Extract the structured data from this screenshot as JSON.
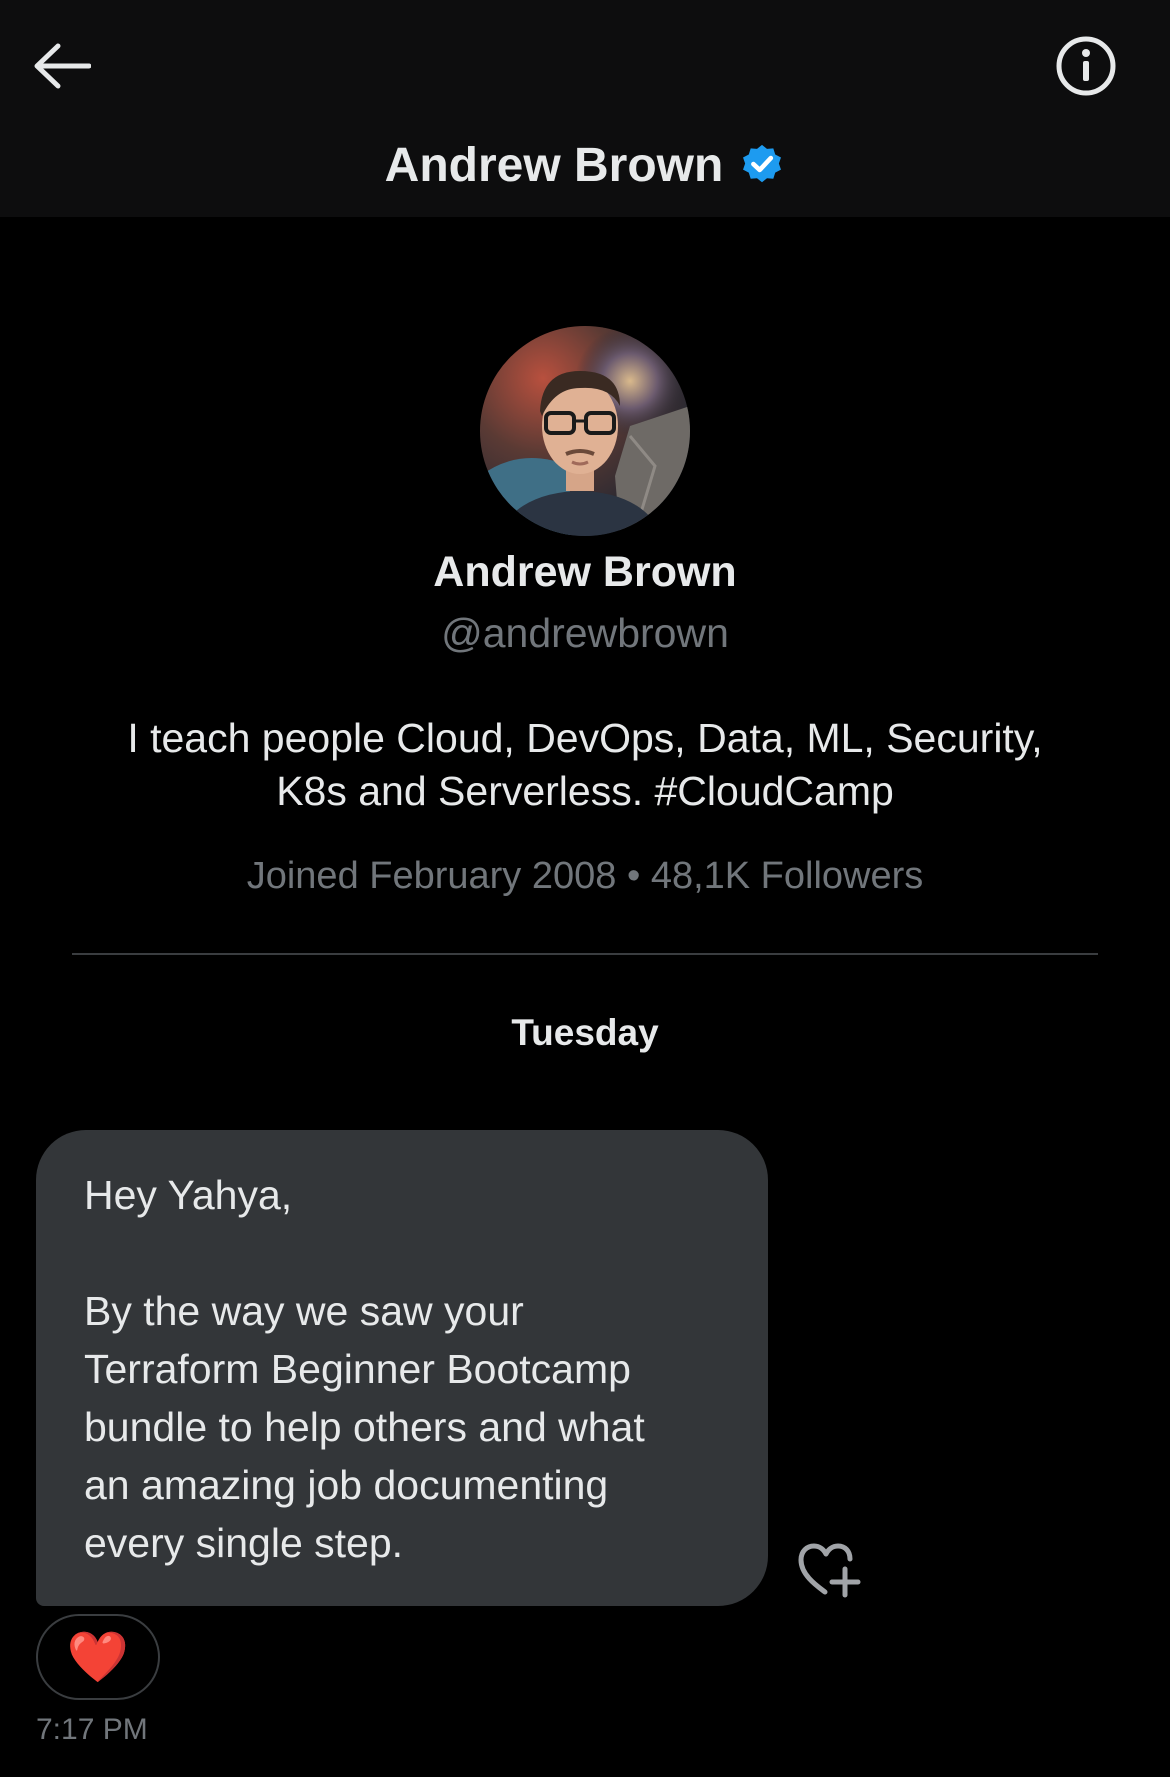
{
  "header": {
    "back_icon": "arrow-left-icon",
    "info_icon": "info-circle-icon",
    "title": "Andrew Brown",
    "verified_icon": "verified-badge-icon",
    "verified_color": "#1d9bf0"
  },
  "profile": {
    "name": "Andrew Brown",
    "handle": "@andrewbrown",
    "bio_line1": "I teach people Cloud, DevOps, Data, ML, Security,",
    "bio_line2": "K8s and Serverless. #CloudCamp",
    "meta": "Joined February 2008 • 48,1K Followers"
  },
  "conversation": {
    "day_label": "Tuesday",
    "message": {
      "greeting": "Hey Yahya,",
      "body_lines": [
        "By the way we saw your",
        "Terraform Beginner Bootcamp",
        "bundle to help others and what",
        "an amazing job documenting",
        "every single step."
      ],
      "reaction": "❤️",
      "add_reaction_icon": "heart-plus-icon",
      "time": "7:17 PM"
    }
  },
  "colors": {
    "background": "#000000",
    "header_bg": "#0d0d0e",
    "bubble_bg": "#333639",
    "primary_text": "#e7e9ea",
    "secondary_text": "#71767b"
  }
}
